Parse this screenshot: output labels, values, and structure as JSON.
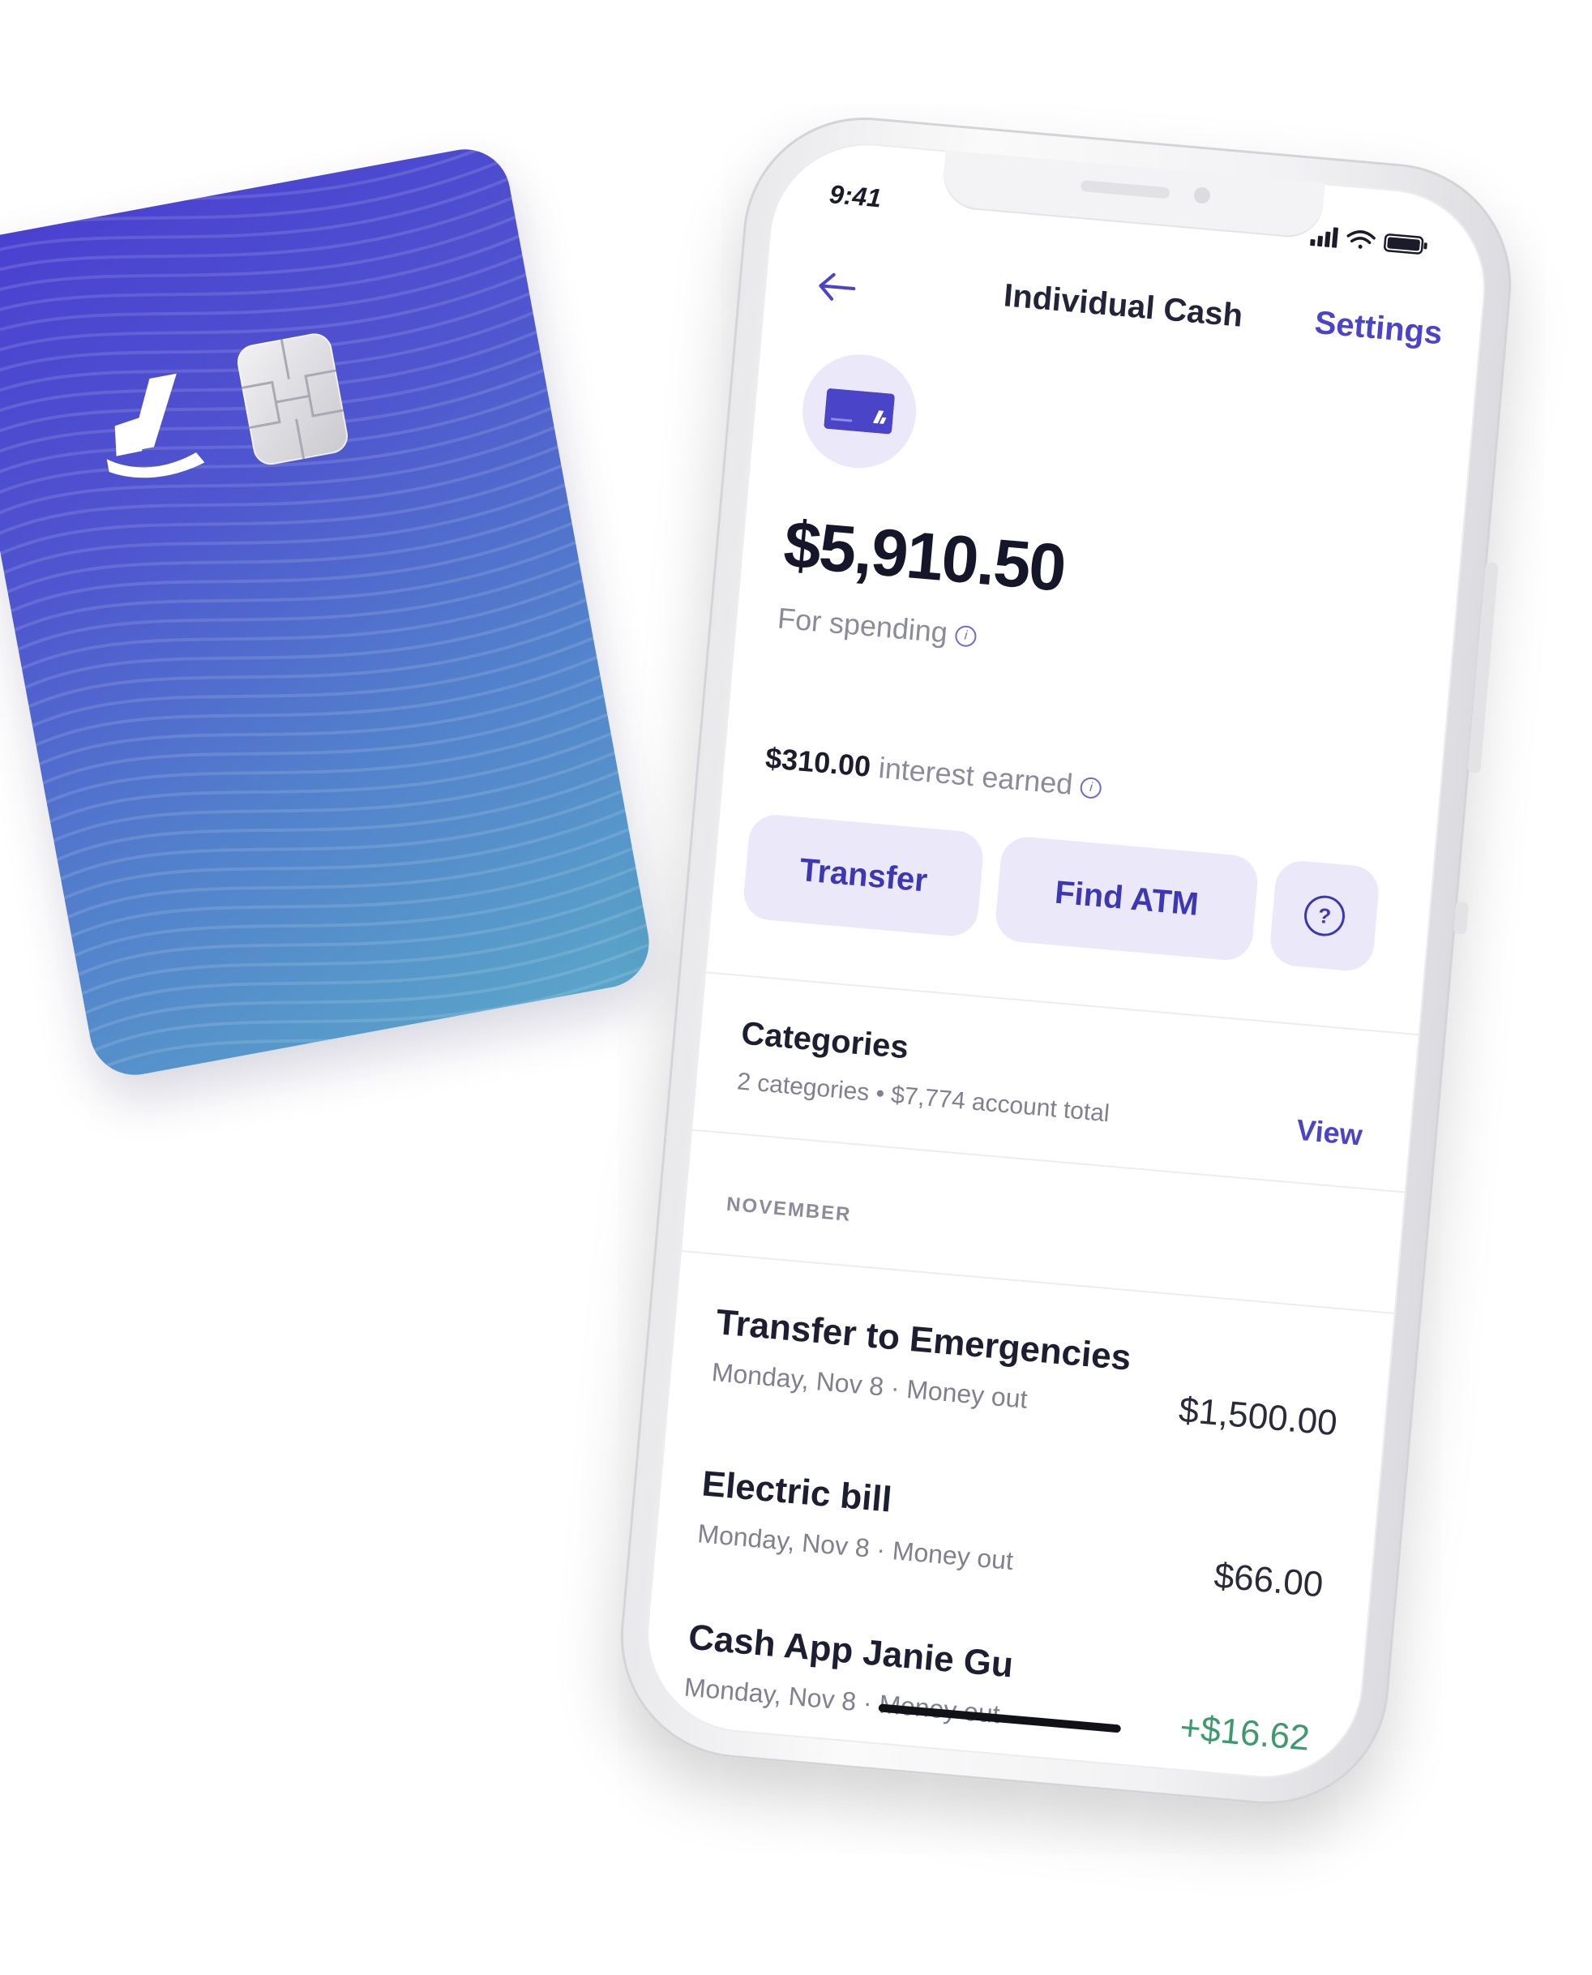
{
  "colors": {
    "accent": "#4b43c8",
    "accent_light": "#ebe9f9",
    "positive": "#3d9a6f",
    "card_gradient_start": "#4a3fd0",
    "card_gradient_end": "#5aa6c9"
  },
  "status_bar": {
    "time": "9:41",
    "icons": [
      "signal-icon",
      "wifi-icon",
      "battery-icon"
    ]
  },
  "nav": {
    "back_icon": "arrow-left-icon",
    "title": "Individual Cash",
    "settings_label": "Settings"
  },
  "account": {
    "icon": "card-icon",
    "balance": "$5,910.50",
    "balance_label": "For spending",
    "interest_amount": "$310.00",
    "interest_label": "interest earned"
  },
  "actions": {
    "transfer_label": "Transfer",
    "find_atm_label": "Find ATM",
    "help_icon": "chat-help-icon"
  },
  "categories": {
    "title": "Categories",
    "subtitle": "2 categories • $7,774 account total",
    "view_label": "View"
  },
  "transactions": {
    "month": "NOVEMBER",
    "items": [
      {
        "title": "Transfer to Emergencies",
        "subtitle": "Monday, Nov 8 · Money out",
        "amount": "$1,500.00",
        "positive": false
      },
      {
        "title": "Electric bill",
        "subtitle": "Monday, Nov 8 · Money out",
        "amount": "$66.00",
        "positive": false
      },
      {
        "title": "Cash App Janie Gu",
        "subtitle": "Monday, Nov 8 · Money out",
        "amount": "+$16.62",
        "positive": true
      }
    ]
  },
  "card": {
    "logo_icon": "wealthfront-logo-icon",
    "chip_icon": "emv-chip-icon"
  }
}
